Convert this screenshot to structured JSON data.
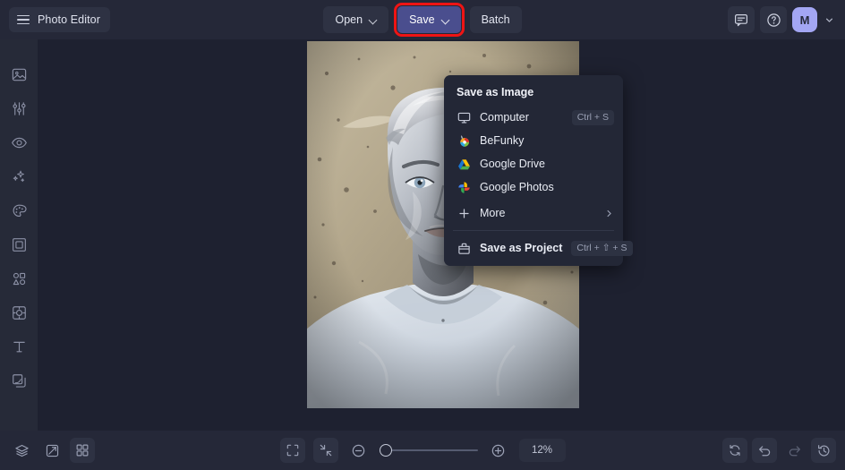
{
  "topbar": {
    "menu_icon": "hamburger-icon",
    "brand": "Photo Editor",
    "open_label": "Open",
    "save_label": "Save",
    "batch_label": "Batch",
    "feedback_icon": "chat-bubble-icon",
    "help_icon": "question-circle-icon",
    "avatar_initial": "M",
    "save_highlight_color": "#ef1414",
    "save_button_color": "#4a4e8e",
    "avatar_color": "#a3a6f3"
  },
  "sidebar": {
    "items": [
      {
        "name": "sidebar-item-edit",
        "icon": "image-icon"
      },
      {
        "name": "sidebar-item-adjust",
        "icon": "sliders-icon"
      },
      {
        "name": "sidebar-item-retouch",
        "icon": "eye-icon"
      },
      {
        "name": "sidebar-item-effects",
        "icon": "sparkles-icon"
      },
      {
        "name": "sidebar-item-artsy",
        "icon": "palette-icon"
      },
      {
        "name": "sidebar-item-frames",
        "icon": "frame-icon"
      },
      {
        "name": "sidebar-item-graphics",
        "icon": "shapes-icon"
      },
      {
        "name": "sidebar-item-overlays",
        "icon": "overlay-icon"
      },
      {
        "name": "sidebar-item-text",
        "icon": "text-icon"
      },
      {
        "name": "sidebar-item-textures",
        "icon": "layers-stack-icon"
      }
    ]
  },
  "save_menu": {
    "title": "Save as Image",
    "items": [
      {
        "label": "Computer",
        "icon": "monitor-icon",
        "shortcut": "Ctrl + S"
      },
      {
        "label": "BeFunky",
        "icon": "befunky-logo-icon",
        "shortcut": ""
      },
      {
        "label": "Google Drive",
        "icon": "google-drive-icon",
        "shortcut": ""
      },
      {
        "label": "Google Photos",
        "icon": "google-photos-icon",
        "shortcut": ""
      },
      {
        "label": "More",
        "icon": "plus-icon",
        "shortcut": "",
        "submenu": true
      }
    ],
    "project": {
      "label": "Save as Project",
      "icon": "project-box-icon",
      "shortcut": "Ctrl + ⇧ + S"
    }
  },
  "bottombar": {
    "left_tools": [
      {
        "name": "layers-button",
        "icon": "layers-icon",
        "active": false
      },
      {
        "name": "blend-button",
        "icon": "blend-icon",
        "active": false
      },
      {
        "name": "grid-button",
        "icon": "grid-icon",
        "active": true
      }
    ],
    "fit_label": "fit-screen-icon",
    "actual_label": "shrink-icon",
    "zoom_out_icon": "minus-circle-icon",
    "zoom_in_icon": "plus-circle-icon",
    "zoom_value": "12%",
    "zoom_percent": 12,
    "right_tools": [
      {
        "name": "reset-button",
        "icon": "reset-icon",
        "framed": true,
        "dim": false
      },
      {
        "name": "undo-button",
        "icon": "undo-icon",
        "framed": true,
        "dim": false
      },
      {
        "name": "redo-button",
        "icon": "redo-icon",
        "framed": false,
        "dim": true
      },
      {
        "name": "history-button",
        "icon": "history-icon",
        "framed": true,
        "dim": false
      }
    ]
  },
  "canvas": {
    "image_name": "edited-portrait",
    "image_description": "Portrait of a person with silver metallic skin and pale grey hair wearing a white t-shirt against a mottled beige speckled background"
  }
}
